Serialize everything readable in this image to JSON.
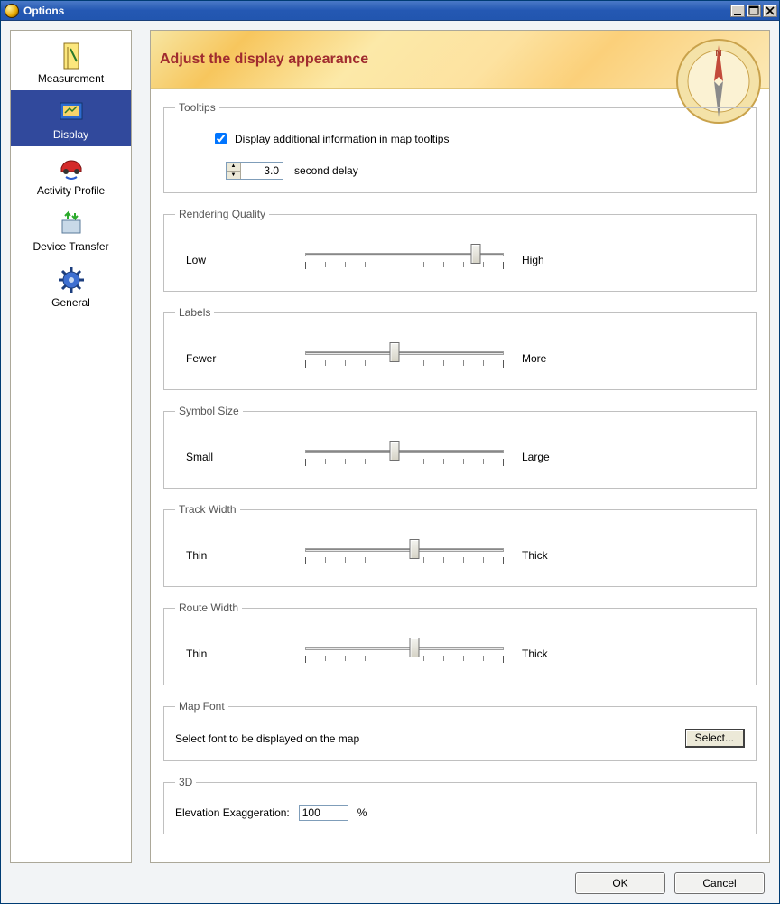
{
  "window": {
    "title": "Options"
  },
  "sidebar": {
    "items": [
      {
        "label": "Measurement"
      },
      {
        "label": "Display"
      },
      {
        "label": "Activity Profile"
      },
      {
        "label": "Device Transfer"
      },
      {
        "label": "General"
      }
    ],
    "selected_index": 1
  },
  "banner": {
    "title": "Adjust the display appearance"
  },
  "tooltips": {
    "legend": "Tooltips",
    "checkbox_label": "Display additional information in map tooltips",
    "checked": true,
    "delay_value": "3.0",
    "delay_suffix": "second delay"
  },
  "sliders": [
    {
      "legend": "Rendering Quality",
      "low": "Low",
      "high": "High",
      "value": 86,
      "ticks": 11
    },
    {
      "legend": "Labels",
      "low": "Fewer",
      "high": "More",
      "value": 45,
      "ticks": 11
    },
    {
      "legend": "Symbol Size",
      "low": "Small",
      "high": "Large",
      "value": 45,
      "ticks": 11
    },
    {
      "legend": "Track Width",
      "low": "Thin",
      "high": "Thick",
      "value": 55,
      "ticks": 11
    },
    {
      "legend": "Route Width",
      "low": "Thin",
      "high": "Thick",
      "value": 55,
      "ticks": 11
    }
  ],
  "mapfont": {
    "legend": "Map Font",
    "desc": "Select font to be displayed on the map",
    "button": "Select..."
  },
  "threeD": {
    "legend": "3D",
    "label": "Elevation Exaggeration:",
    "value": "100",
    "unit": "%"
  },
  "footer": {
    "ok": "OK",
    "cancel": "Cancel"
  }
}
